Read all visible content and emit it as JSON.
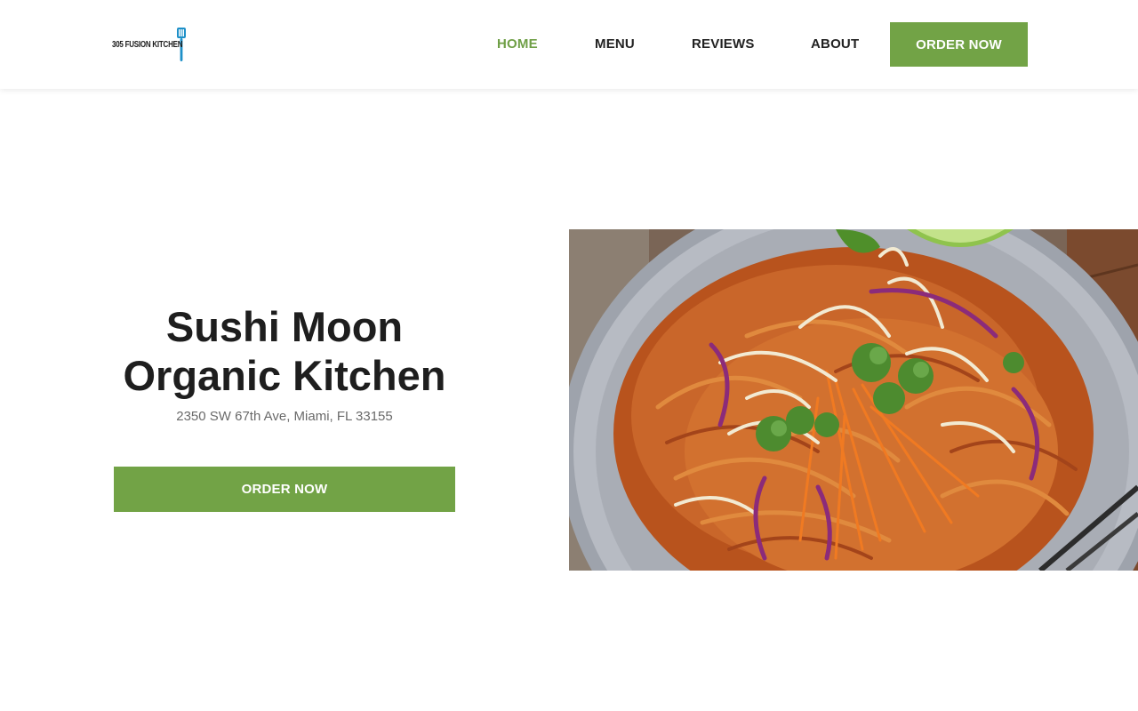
{
  "header": {
    "logo_text": "305 FUSION KITCHEN",
    "nav": [
      {
        "label": "HOME",
        "active": true
      },
      {
        "label": "MENU",
        "active": false
      },
      {
        "label": "REVIEWS",
        "active": false
      },
      {
        "label": "ABOUT",
        "active": false
      }
    ],
    "order_label": "ORDER NOW"
  },
  "hero": {
    "title_line1": "Sushi Moon",
    "title_line2": "Organic Kitchen",
    "address": "2350 SW 67th Ave, Miami, FL 33155",
    "order_label": "ORDER NOW",
    "image_icon": "pad-thai-photo"
  },
  "colors": {
    "accent": "#72a346",
    "active_nav": "#6f9f46",
    "text_dark": "#1e1e1e",
    "text_muted": "#6a6a6a",
    "logo_icon": "#1e90c8"
  }
}
